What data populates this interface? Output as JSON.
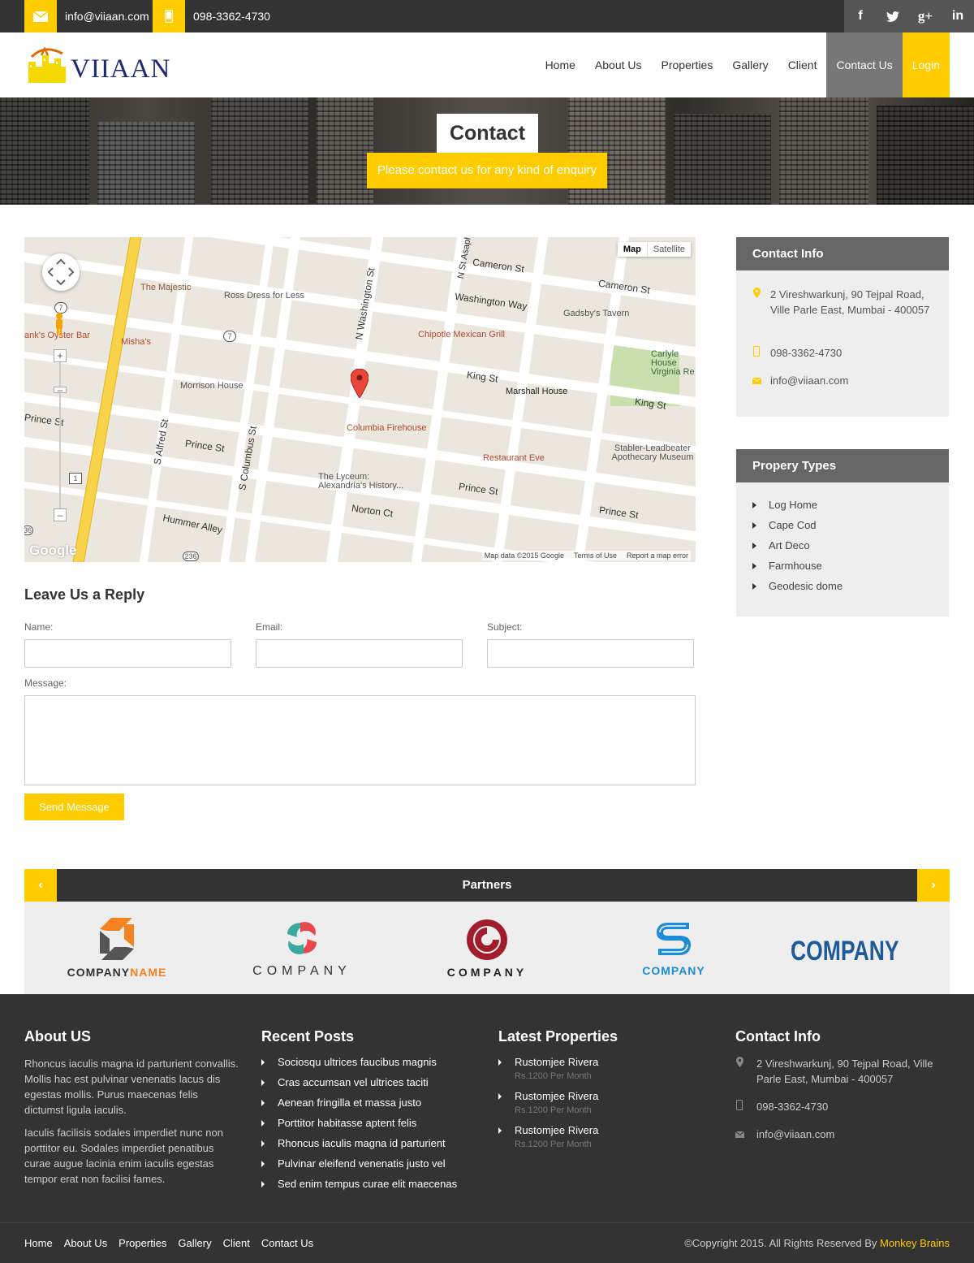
{
  "topbar": {
    "email": "info@viiaan.com",
    "phone": "098-3362-4730",
    "social_icons": [
      "facebook-icon",
      "twitter-icon",
      "google-plus-icon",
      "linkedin-icon"
    ]
  },
  "brand": {
    "name": "VIIAAN"
  },
  "nav": {
    "home": "Home",
    "about": "About Us",
    "properties": "Properties",
    "gallery": "Gallery",
    "client": "Client",
    "contact": "Contact Us",
    "login": "Login"
  },
  "hero": {
    "title": "Contact",
    "subtitle": "Please contact us for any kind of enquiry"
  },
  "map": {
    "type_map": "Map",
    "type_satellite": "Satellite",
    "streets": [
      "Cameron St",
      "Cameron St",
      "Washington Way",
      "King St",
      "King St",
      "Prince St",
      "Prince St",
      "Prince St",
      "Prince St",
      "Norton Ct",
      "Hummer Alley",
      "N Washington St",
      "S Alfred St",
      "S Columbus St",
      "N St Asaph"
    ],
    "pois": [
      "The Majestic",
      "Ross Dress for Less",
      "Gadsby's Tavern",
      "Chipotle Mexican Grill",
      "Misha's",
      "ank's Oyster Bar",
      "Morrison House",
      "Marshall House",
      "Carlyle House Virginia Re",
      "Columbia Firehouse",
      "Restaurant Eve",
      "Stabler-Leadbeater Apothecary Museum",
      "The Lyceum: Alexandria's History..."
    ],
    "route_labels": [
      "7",
      "7",
      "1",
      "236",
      "36"
    ],
    "footer": [
      "Map data ©2015 Google",
      "Terms of Use",
      "Report a map error"
    ],
    "logo": "Google"
  },
  "form": {
    "heading": "Leave Us a Reply",
    "name_label": "Name:",
    "email_label": "Email:",
    "subject_label": "Subject:",
    "message_label": "Message:",
    "submit": "Send Message"
  },
  "contact_info": {
    "heading": "Contact Info",
    "address": "2 Vireshwarkunj, 90 Tejpal Road, Ville Parle East, Mumbai - 400057",
    "phone": "098-3362-4730",
    "email": "info@viiaan.com"
  },
  "property_types": {
    "heading": "Propery Types",
    "items": [
      "Log Home",
      "Cape Cod",
      "Art Deco",
      "Farmhouse",
      "Geodesic dome"
    ]
  },
  "partners": {
    "heading": "Partners",
    "logos": [
      "COMPANYNAME",
      "COMPANY",
      "COMPANY",
      "COMPANY",
      "COMPANY"
    ],
    "logo1_a": "COMPANY",
    "logo1_b": "NAME"
  },
  "footer": {
    "about": {
      "heading": "About US",
      "p1": "Rhoncus iaculis magna id parturient convallis. Mollis hac est pulvinar venenatis lacus dis egestas mollis. Purus maecenas felis dictumst ligula iaculis.",
      "p2": "Iaculis facilisis sodales imperdiet nunc non porttitor eu. Sodales imperdiet penatibus curae augue lacinia enim iaculis egestas tempor erat non facilisi fames."
    },
    "recent_posts": {
      "heading": "Recent Posts",
      "items": [
        "Sociosqu ultrices faucibus magnis",
        "Cras accumsan vel ultrices taciti",
        "Aenean fringilla et massa justo",
        "Porttitor habitasse aptent felis",
        "Rhoncus iaculis magna id parturient",
        "Pulvinar eleifend venenatis justo vel",
        "Sed enim tempus curae elit maecenas"
      ]
    },
    "latest_properties": {
      "heading": "Latest Properties",
      "items": [
        {
          "name": "Rustomjee Rivera",
          "price": "Rs.1200 Per Month"
        },
        {
          "name": "Rustomjee Rivera",
          "price": "Rs.1200 Per Month"
        },
        {
          "name": "Rustomjee Rivera",
          "price": "Rs.1200 Per Month"
        }
      ]
    },
    "contact": {
      "heading": "Contact Info",
      "address": "2 Vireshwarkunj, 90 Tejpal Road, Ville Parle East, Mumbai - 400057",
      "phone": "098-3362-4730",
      "email": "info@viiaan.com"
    }
  },
  "bottom": {
    "links": [
      "Home",
      "About Us",
      "Properties",
      "Gallery",
      "Client",
      "Contact Us"
    ],
    "copyright": "©Copyright 2015. All Rights Reserved By ",
    "author": "Monkey Brains"
  },
  "colors": {
    "accent": "#ffcc00",
    "dark": "#333333",
    "mid": "#666666"
  }
}
